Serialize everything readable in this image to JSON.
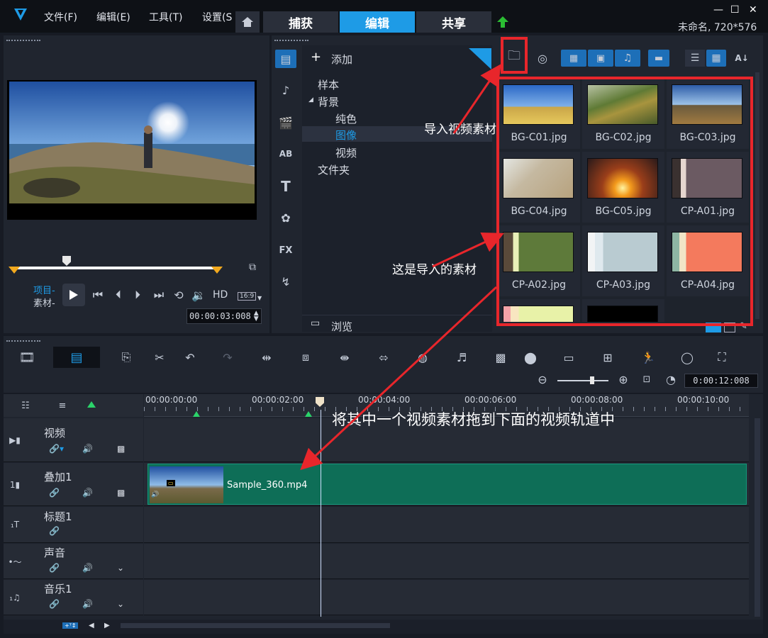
{
  "menu": [
    "文件(F)",
    "编辑(E)",
    "工具(T)",
    "设置(S"
  ],
  "mode_tabs": [
    "捕获",
    "编辑",
    "共享"
  ],
  "project_info": "未命名, 720*576",
  "library": {
    "add_label": "添加",
    "tree": [
      "样本",
      "背景",
      "纯色",
      "图像",
      "视频",
      "文件夹"
    ],
    "browse_label": "浏览",
    "thumbnails": [
      "BG-C01.jpg",
      "BG-C02.jpg",
      "BG-C03.jpg",
      "BG-C04.jpg",
      "BG-C05.jpg",
      "CP-A01.jpg",
      "CP-A02.jpg",
      "CP-A03.jpg",
      "CP-A04.jpg"
    ]
  },
  "player": {
    "project_label": "项目-",
    "clip_label": "素材-",
    "hd_label": "HD",
    "aspect_label": "16:9",
    "timecode": "00:00:03:008"
  },
  "toolbar": {
    "duration": "0:00:12:008",
    "side_icons": [
      "FX"
    ]
  },
  "timeline": {
    "ruler": [
      "00:00:00:00",
      "00:00:02:00",
      "00:00:04:00",
      "00:00:06:00",
      "00:00:08:00",
      "00:00:10:00"
    ],
    "tracks": [
      "视频",
      "叠加1",
      "标题1",
      "声音",
      "音乐1"
    ],
    "clip_name": "Sample_360.mp4"
  },
  "annotations": {
    "import": "导入视频素材",
    "imported": "这是导入的素材",
    "drag": "将其中一个视频素材拖到下面的视频轨道中"
  },
  "colors": {
    "accent": "#1e9be6",
    "clip": "#0e6e57",
    "annotation": "#e8262b"
  }
}
